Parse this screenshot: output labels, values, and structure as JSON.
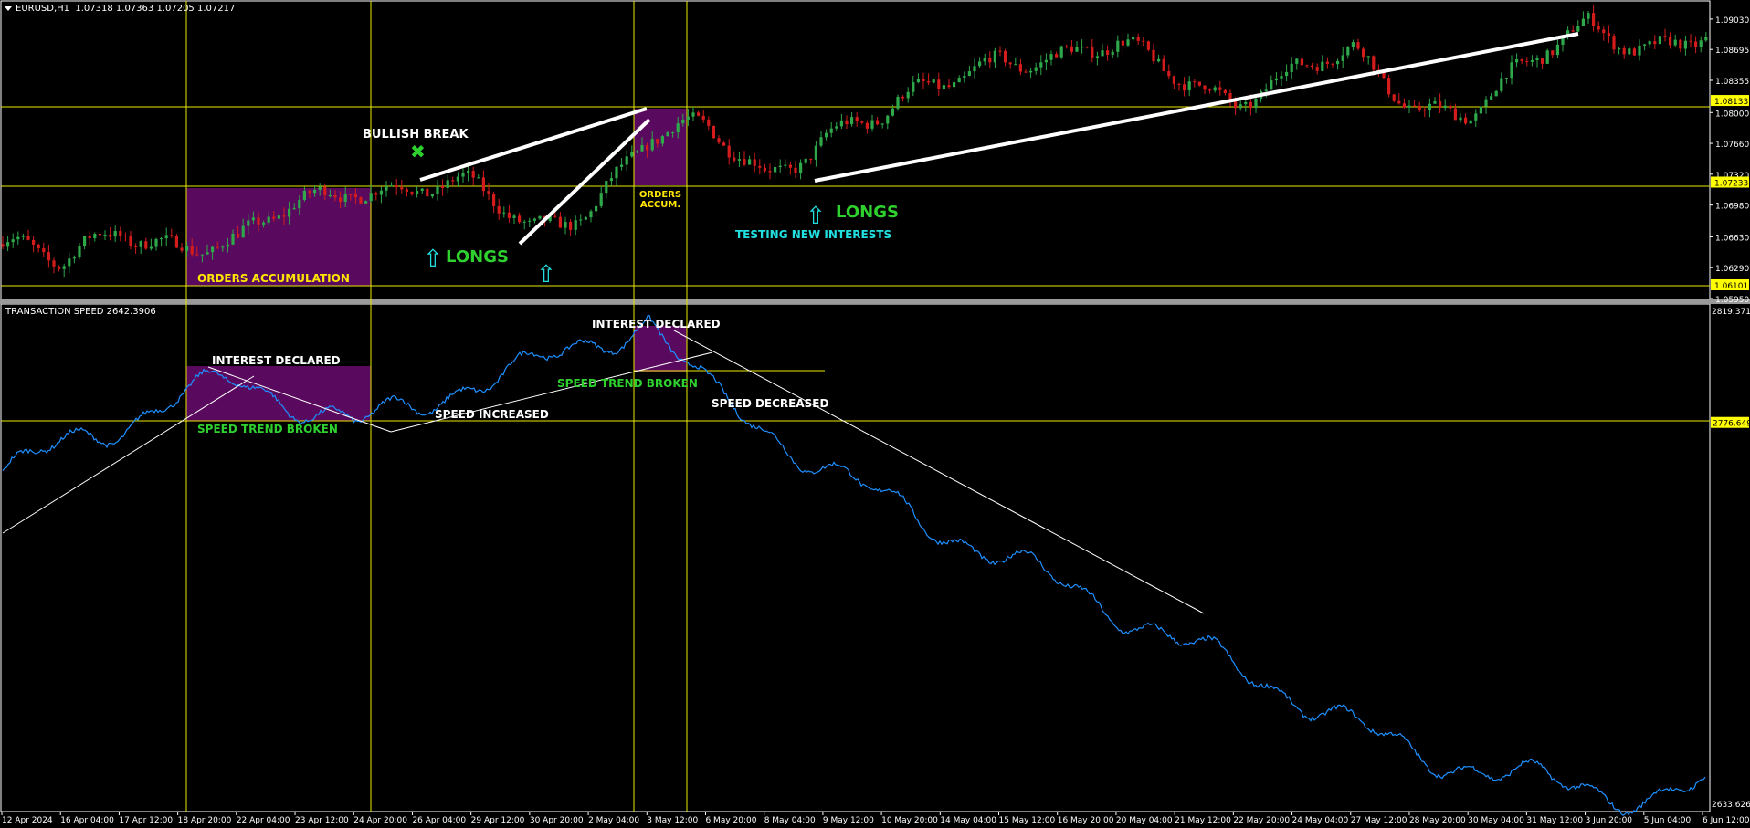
{
  "header": {
    "symbol": "EURUSD,H1",
    "ohlc": "1.07318 1.07363 1.07205 1.07217"
  },
  "indicator": {
    "name": "TRANSACTION SPEED 2642.3906"
  },
  "price_axis": {
    "ticks": [
      "1.09030",
      "1.08695",
      "1.08355",
      "1.08000",
      "1.07660",
      "1.07320",
      "1.06980",
      "1.06630",
      "1.06290",
      "1.05950"
    ],
    "tags": [
      "1.08133",
      "1.07233",
      "1.06101"
    ]
  },
  "speed_axis": {
    "ticks": [
      "2819.3717",
      "2633.6269"
    ],
    "tags": [
      "2776.6499"
    ]
  },
  "time_axis": {
    "labels": [
      "12 Apr 2024",
      "16 Apr 04:00",
      "17 Apr 12:00",
      "18 Apr 20:00",
      "22 Apr 04:00",
      "23 Apr 12:00",
      "24 Apr 20:00",
      "26 Apr 04:00",
      "29 Apr 12:00",
      "30 Apr 20:00",
      "2 May 04:00",
      "3 May 12:00",
      "6 May 20:00",
      "8 May 04:00",
      "9 May 12:00",
      "10 May 20:00",
      "14 May 04:00",
      "15 May 12:00",
      "16 May 20:00",
      "20 May 04:00",
      "21 May 12:00",
      "22 May 20:00",
      "24 May 04:00",
      "27 May 12:00",
      "28 May 20:00",
      "30 May 04:00",
      "31 May 12:00",
      "3 Jun 20:00",
      "5 Jun 04:00",
      "6 Jun 12:00"
    ]
  },
  "annotations": {
    "bullish_break": "BULLISH BREAK",
    "orders_accumulation": "ORDERS ACCUMULATION",
    "orders_accum_line1": "ORDERS",
    "orders_accum_line2": "ACCUM.",
    "longs_1": "LONGS",
    "longs_2": "LONGS",
    "testing_new_interests": "TESTING NEW INTERESTS",
    "interest_declared_1": "INTEREST DECLARED",
    "interest_declared_2": "INTEREST DECLARED",
    "speed_trend_broken_1": "SPEED TREND BROKEN",
    "speed_trend_broken_2": "SPEED TREND BROKEN",
    "speed_increased": "SPEED INCREASED",
    "speed_decreased": "SPEED DECREASED"
  },
  "colors": {
    "background": "#000000",
    "bull_candle": "#2ea84a",
    "bear_candle": "#d41c1c",
    "level_line": "#e8e800",
    "zone_fill": "#5a0a5e",
    "speed_line": "#1e90ff",
    "annotation_green": "#2fd12f",
    "annotation_cyan": "#22e0e0",
    "annotation_yellow": "#ffe600",
    "axis_text": "#ffffff",
    "tag_bg": "#ffff00"
  },
  "chart_data": [
    {
      "type": "candlestick",
      "title": "EURUSD,H1",
      "series": [
        {
          "name": "EURUSD,H1",
          "x": [
            "12 Apr 2024",
            "16 Apr 04:00",
            "17 Apr 12:00",
            "18 Apr 20:00",
            "22 Apr 04:00",
            "23 Apr 12:00",
            "24 Apr 20:00",
            "26 Apr 04:00",
            "29 Apr 12:00",
            "30 Apr 20:00",
            "2 May 04:00",
            "3 May 12:00",
            "6 May 20:00",
            "8 May 04:00",
            "9 May 12:00",
            "10 May 20:00",
            "14 May 04:00",
            "15 May 12:00",
            "16 May 20:00",
            "20 May 04:00",
            "21 May 12:00",
            "22 May 20:00",
            "24 May 04:00",
            "27 May 12:00",
            "28 May 20:00",
            "30 May 04:00",
            "31 May 12:00",
            "3 Jun 20:00",
            "5 Jun 04:00",
            "6 Jun 12:00"
          ],
          "close": [
            1.0655,
            1.0625,
            1.0675,
            1.066,
            1.065,
            1.0695,
            1.0725,
            1.072,
            1.071,
            1.067,
            1.0705,
            1.077,
            1.0775,
            1.0735,
            1.078,
            1.079,
            1.083,
            1.087,
            1.086,
            1.0865,
            1.0845,
            1.082,
            1.084,
            1.086,
            1.0815,
            1.0805,
            1.0845,
            1.0895,
            1.088,
            1.0885
          ]
        }
      ],
      "ylim": [
        1.0595,
        1.092
      ]
    },
    {
      "type": "line",
      "title": "TRANSACTION SPEED 2642.3906",
      "series": [
        {
          "name": "TRANSACTION SPEED",
          "x": [
            "12 Apr 2024",
            "16 Apr 04:00",
            "17 Apr 12:00",
            "18 Apr 20:00",
            "22 Apr 04:00",
            "23 Apr 12:00",
            "24 Apr 20:00",
            "26 Apr 04:00",
            "29 Apr 12:00",
            "30 Apr 20:00",
            "2 May 04:00",
            "3 May 12:00",
            "6 May 20:00",
            "8 May 04:00",
            "9 May 12:00",
            "10 May 20:00",
            "14 May 04:00",
            "15 May 12:00",
            "16 May 20:00",
            "20 May 04:00",
            "21 May 12:00",
            "22 May 20:00",
            "24 May 04:00",
            "27 May 12:00",
            "28 May 20:00",
            "30 May 04:00",
            "31 May 12:00",
            "3 Jun 20:00",
            "5 Jun 04:00",
            "6 Jun 12:00"
          ],
          "values": [
            2757,
            2768,
            2776,
            2786,
            2792,
            2784,
            2776,
            2782,
            2792,
            2797,
            2805,
            2815,
            2788,
            2774,
            2760,
            2748,
            2737,
            2727,
            2717,
            2707,
            2696,
            2686,
            2676,
            2665,
            2654,
            2650,
            2645,
            2641,
            2638,
            2642
          ]
        }
      ],
      "ylim": [
        2633.6269,
        2819.3717
      ]
    }
  ]
}
